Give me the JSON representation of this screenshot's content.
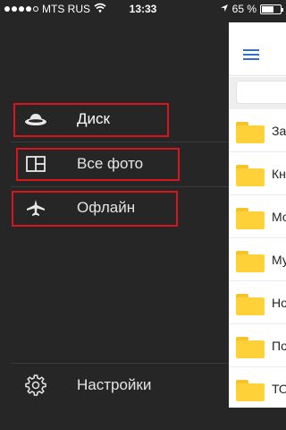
{
  "status_bar": {
    "carrier": "MTS RUS",
    "time": "13:33",
    "battery": "65 %",
    "battery_level": 0.65,
    "signal_dots_filled": 4,
    "signal_dots_total": 5
  },
  "menu": {
    "items": [
      {
        "label": "Диск",
        "icon": "disk-icon"
      },
      {
        "label": "Все фото",
        "icon": "photos-icon"
      },
      {
        "label": "Офлайн",
        "icon": "airplane-icon"
      }
    ],
    "settings": {
      "label": "Настройки",
      "icon": "gear-icon"
    }
  },
  "content": {
    "files": [
      "За",
      "Кн",
      "Мо",
      "Му",
      "Но",
      "По",
      "ТО"
    ]
  },
  "colors": {
    "background": "#262626",
    "highlight": "#d8141c",
    "accent": "#2f6fd6",
    "folder": "#ffd139"
  }
}
